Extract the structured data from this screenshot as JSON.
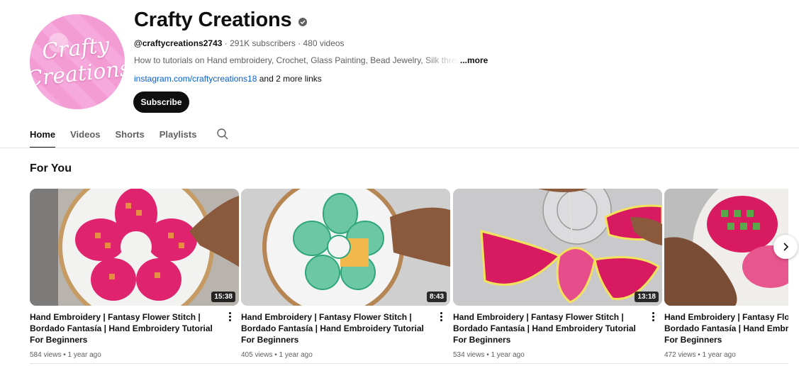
{
  "channel": {
    "avatar_text_line1": "Crafty",
    "avatar_text_line2": "Creations",
    "name": "Crafty Creations",
    "handle": "@craftycreations2743",
    "subscribers": "291K subscribers",
    "videos": "480 videos",
    "separator": " · ",
    "description": "How to tutorials on Hand embroidery, Crochet, Glass Painting, Bead Jewelry, Silk thread",
    "more_label": "...more",
    "link": "instagram.com/craftycreations18",
    "more_links": " and 2 more links",
    "subscribe_label": "Subscribe",
    "accent": "#0f0f0f",
    "avatar_color": "#f39bd3"
  },
  "tabs": [
    {
      "label": "Home",
      "active": true
    },
    {
      "label": "Videos",
      "active": false
    },
    {
      "label": "Shorts",
      "active": false
    },
    {
      "label": "Playlists",
      "active": false
    }
  ],
  "tab_search_icon": "search-icon",
  "section": {
    "title": "For You"
  },
  "videos": [
    {
      "title": "Hand Embroidery | Fantasy Flower Stitch | Bordado Fantasía | Hand Embroidery Tutorial For Beginners",
      "duration": "15:38",
      "views": "584 views",
      "age": "1 year ago"
    },
    {
      "title": "Hand Embroidery | Fantasy Flower Stitch | Bordado Fantasía | Hand Embroidery Tutorial For Beginners",
      "duration": "8:43",
      "views": "405 views",
      "age": "1 year ago"
    },
    {
      "title": "Hand Embroidery | Fantasy Flower Stitch | Bordado Fantasía | Hand Embroidery Tutorial For Beginners",
      "duration": "13:18",
      "views": "534 views",
      "age": "1 year ago"
    },
    {
      "title": "Hand Embroidery | Fantasy Flower Stitch | Bordado Fantasía | Hand Embroidery Tutorial For Beginners",
      "duration": "",
      "views": "472 views",
      "age": "1 year ago"
    }
  ],
  "stats_separator": " • ",
  "next_icon": "chevron-right-icon"
}
